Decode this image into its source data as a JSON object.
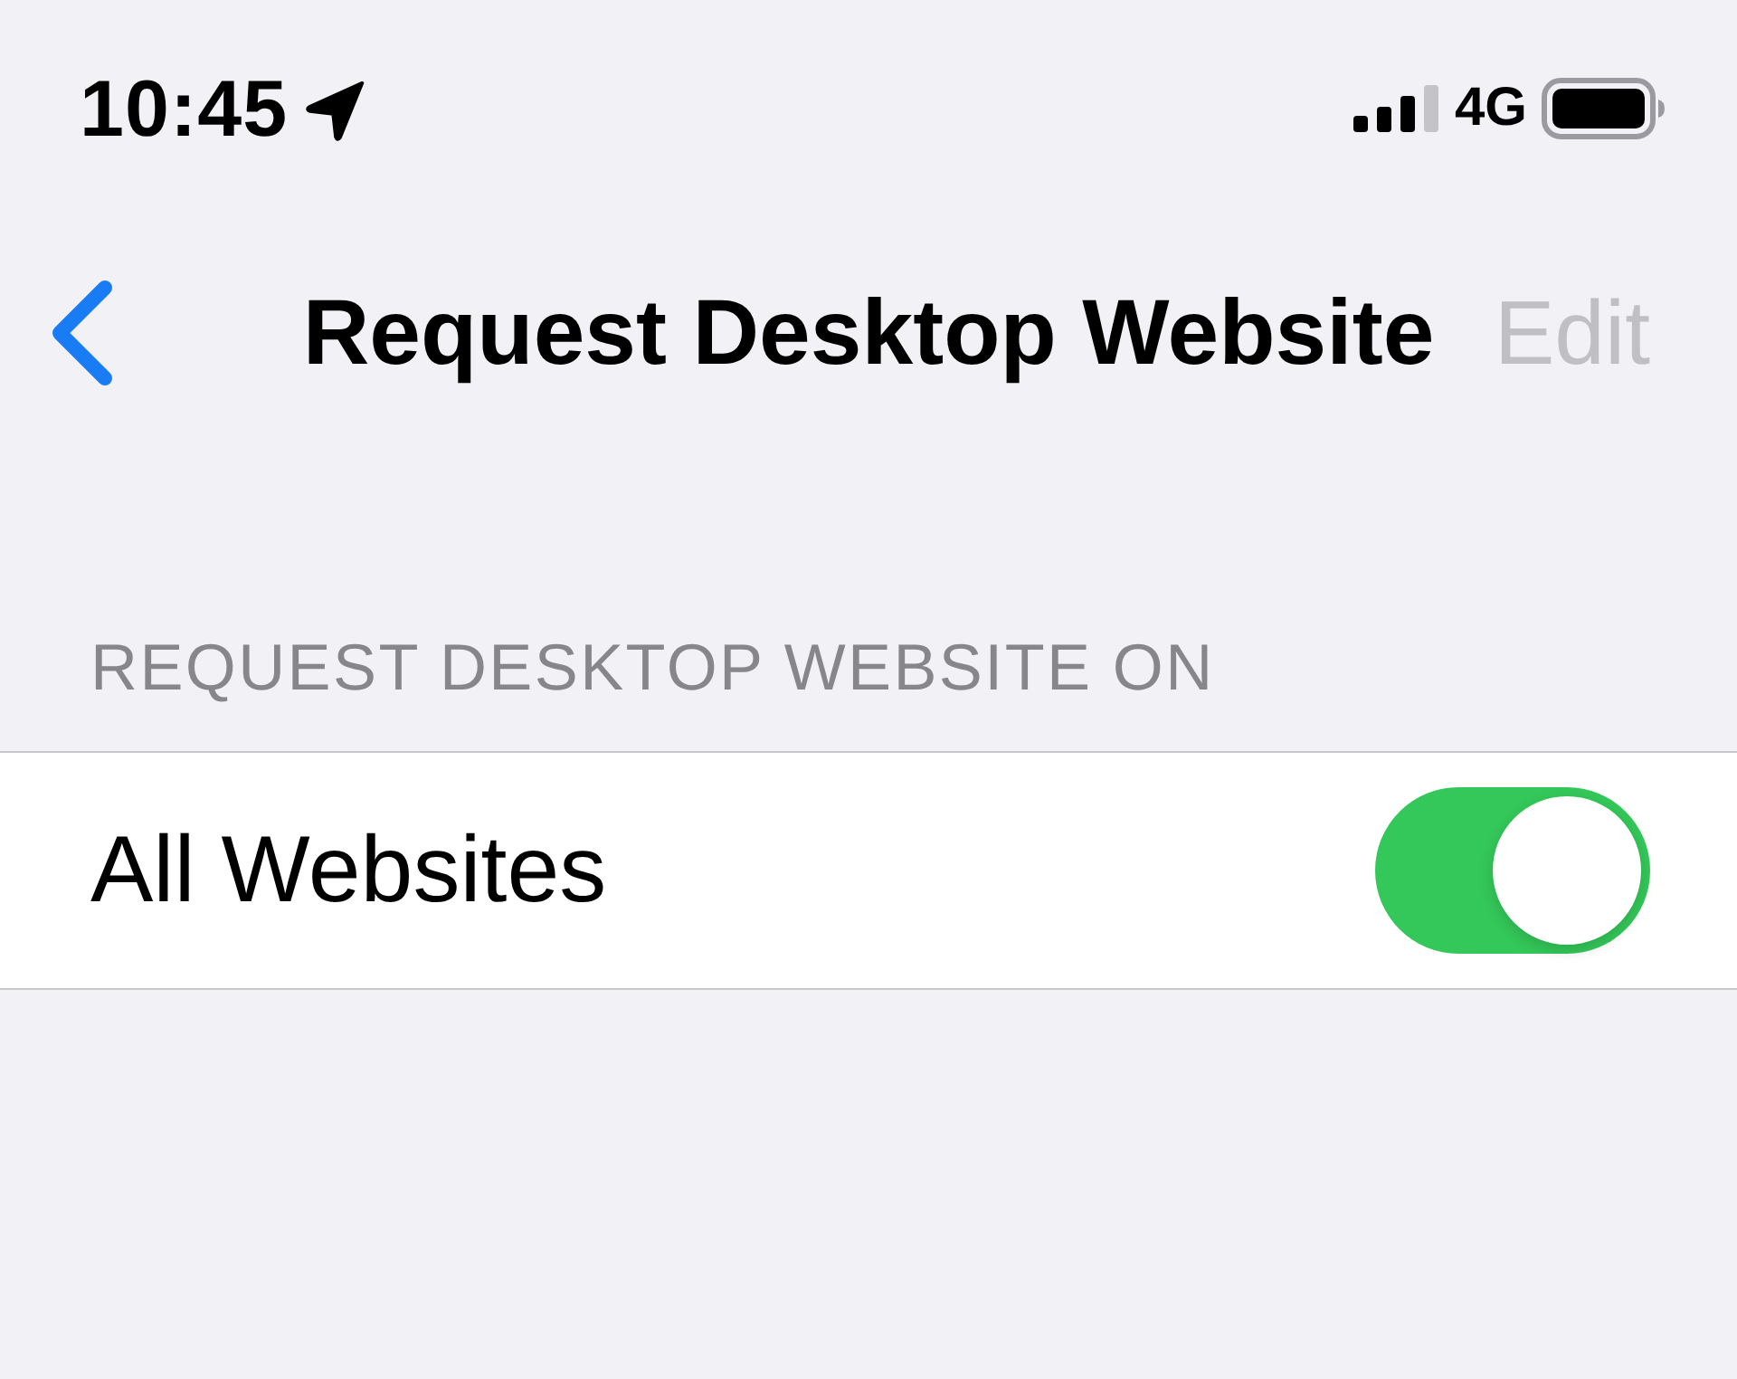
{
  "status_bar": {
    "time": "10:45",
    "network": "4G"
  },
  "nav_bar": {
    "title": "Request Desktop Website",
    "edit_button": {
      "label": "Edit",
      "disabled": true
    }
  },
  "section": {
    "header": "REQUEST DESKTOP WEBSITE ON",
    "rows": [
      {
        "label": "All Websites",
        "kind": "toggle",
        "on": true
      }
    ]
  }
}
